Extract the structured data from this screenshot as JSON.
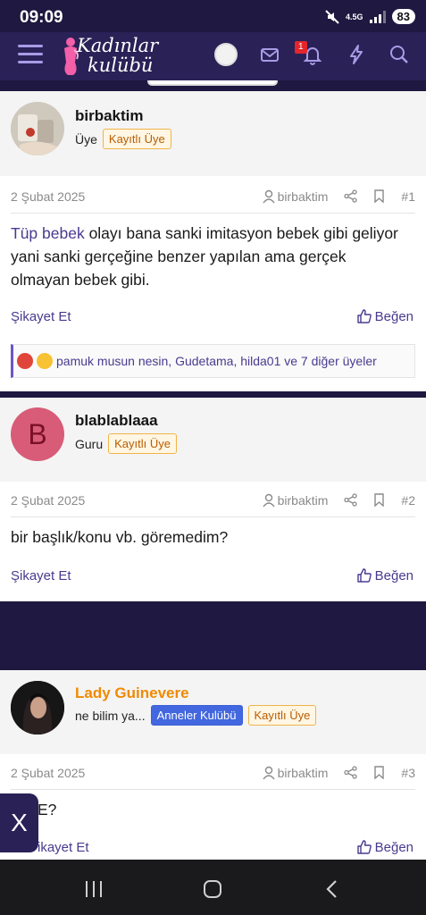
{
  "status": {
    "time": "09:09",
    "network": "4.5G",
    "battery": "83"
  },
  "nav": {
    "logo_line1": "Kadınlar",
    "logo_line2": "kulübü",
    "notification_count": "1"
  },
  "posts": [
    {
      "username": "birbaktim",
      "title": "Üye",
      "badges": [
        "Kayıtlı Üye"
      ],
      "date": "2 Şubat 2025",
      "quoted_user": "birbaktim",
      "number": "#1",
      "body_link": "Tüp bebek",
      "body_text": " olayı bana sanki imitasyon bebek gibi geliyor yani sanki gerçeğine benzer yapılan ama gerçek olmayan bebek gibi.",
      "report_label": "Şikayet Et",
      "like_label": "Beğen",
      "reactions_text": "pamuk musun nesin, Gudetama, hilda01 ve 7 diğer üyeler"
    },
    {
      "username": "blablablaaa",
      "avatar_letter": "B",
      "title": "Guru",
      "badges": [
        "Kayıtlı Üye"
      ],
      "date": "2 Şubat 2025",
      "quoted_user": "birbaktim",
      "number": "#2",
      "body_text": "bir başlık/konu vb. göremedim?",
      "report_label": "Şikayet Et",
      "like_label": "Beğen"
    },
    {
      "username": "Lady Guinevere",
      "title": "ne bilim ya...",
      "badges": [
        "Anneler Kulübü",
        "Kayıtlı Üye"
      ],
      "date": "2 Şubat 2025",
      "quoted_user": "birbaktim",
      "number": "#3",
      "body_text": "E?",
      "report_label": "ikayet Et",
      "like_label": "Beğen"
    }
  ],
  "floating": {
    "close_label": "X"
  },
  "colors": {
    "brand_dark": "#2a2157",
    "link": "#4a3a8f",
    "accent_orange": "#f08a00"
  }
}
